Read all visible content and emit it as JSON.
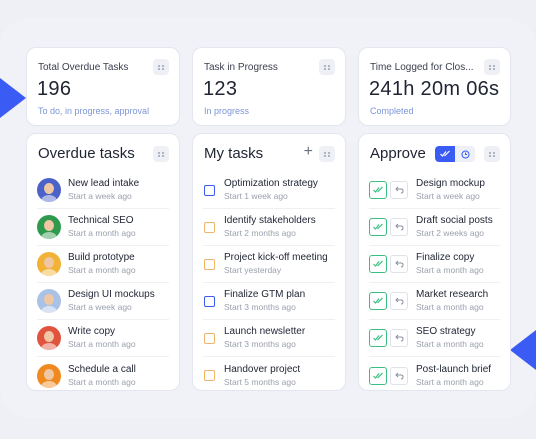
{
  "stats": [
    {
      "label": "Total Overdue Tasks",
      "value": "196",
      "sub": "To do, in progress, approval"
    },
    {
      "label": "Task in Progress",
      "value": "123",
      "sub": "In progress"
    },
    {
      "label": "Time Logged for Clos...",
      "value": "241h 20m 06s",
      "sub": "Completed"
    }
  ],
  "overdue": {
    "title": "Overdue tasks",
    "items": [
      {
        "name": "New lead intake",
        "time": "Start a week ago",
        "avatar_color": "#4b63c9"
      },
      {
        "name": "Technical SEO",
        "time": "Start a month ago",
        "avatar_color": "#2f9a4e"
      },
      {
        "name": "Build prototype",
        "time": "Start a month ago",
        "avatar_color": "#f2b236"
      },
      {
        "name": "Design UI mockups",
        "time": "Start a week ago",
        "avatar_color": "#a9c2e6"
      },
      {
        "name": "Write copy",
        "time": "Start a month ago",
        "avatar_color": "#e0533c"
      },
      {
        "name": "Schedule a call",
        "time": "Start a month ago",
        "avatar_color": "#f08a1e"
      }
    ]
  },
  "mytasks": {
    "title": "My tasks",
    "add_icon": "plus-icon",
    "items": [
      {
        "name": "Optimization strategy",
        "time": "Start 1 week ago",
        "status": "blue"
      },
      {
        "name": "Identify stakeholders",
        "time": "Start 2 months ago",
        "status": "orange"
      },
      {
        "name": "Project kick-off meeting",
        "time": "Start yesterday",
        "status": "orange"
      },
      {
        "name": "Finalize GTM plan",
        "time": "Start 3 months ago",
        "status": "blue"
      },
      {
        "name": "Launch newsletter",
        "time": "Start 3 months ago",
        "status": "orange"
      },
      {
        "name": "Handover project",
        "time": "Start 5 months ago",
        "status": "orange"
      }
    ]
  },
  "approve": {
    "title": "Approve",
    "items": [
      {
        "name": "Design mockup",
        "time": "Start a week ago"
      },
      {
        "name": "Draft social posts",
        "time": "Start 2 weeks ago"
      },
      {
        "name": "Finalize copy",
        "time": "Start a month ago"
      },
      {
        "name": "Market research",
        "time": "Start a month ago"
      },
      {
        "name": "SEO strategy",
        "time": "Start a month ago"
      },
      {
        "name": "Post-launch brief",
        "time": "Start a month ago"
      }
    ]
  },
  "colors": {
    "accent": "#3b5bf5",
    "approve_green": "#3cbf82",
    "pending_orange": "#f2b468",
    "subtext_blue": "#7b95d8"
  }
}
